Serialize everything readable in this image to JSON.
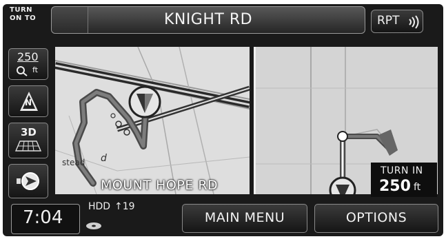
{
  "header": {
    "turn_on_to_line1": "TURN",
    "turn_on_to_line2": "ON TO",
    "street_name": "KNIGHT RD",
    "repeat_label": "RPT"
  },
  "side_controls": {
    "zoom_value": "250",
    "zoom_unit": "ft",
    "north_label": "N",
    "view_label": "3D"
  },
  "map": {
    "current_road": "MOUNT HOPE RD",
    "map_text_d": "d"
  },
  "turn_panel": {
    "label": "TURN IN",
    "distance": "250",
    "unit": "ft"
  },
  "status": {
    "time": "7:04",
    "source": "HDD",
    "track_indicator": "↑19"
  },
  "bottom_bar": {
    "main_menu": "MAIN MENU",
    "options": "OPTIONS"
  }
}
